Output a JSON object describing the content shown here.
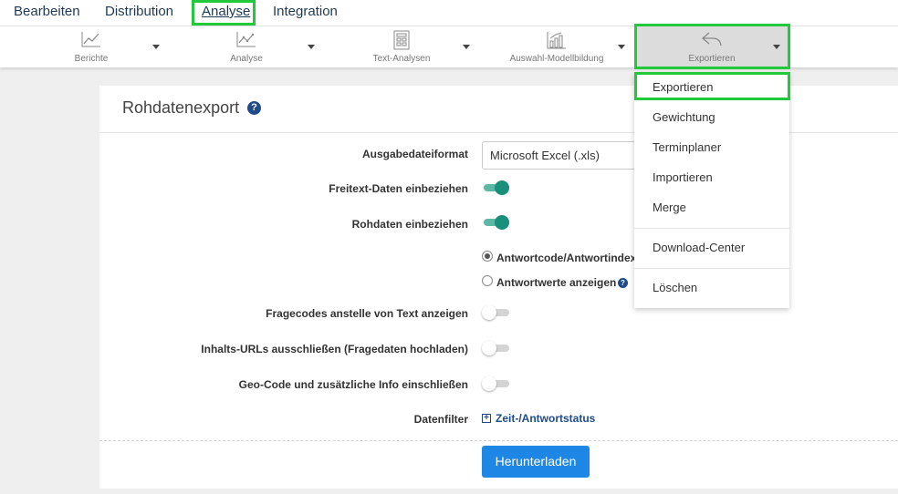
{
  "topmenu": {
    "items": [
      "Bearbeiten",
      "Distribution",
      "Analyse",
      "Integration"
    ],
    "active": "Analyse"
  },
  "toolbar": {
    "tools": [
      {
        "label": "Berichte",
        "icon": "line-chart-icon"
      },
      {
        "label": "Analyse",
        "icon": "scatter-chart-icon"
      },
      {
        "label": "Text-Analysen",
        "icon": "text-analysis-icon"
      },
      {
        "label": "Auswahl-Modellbildung",
        "icon": "model-chart-icon"
      },
      {
        "label": "Exportieren",
        "icon": "export-arrow-icon"
      }
    ]
  },
  "panel": {
    "title": "Rohdatenexport",
    "format_label": "Ausgabedateiformat",
    "format_value": "Microsoft Excel (.xls)",
    "freitext_label": "Freitext-Daten einbeziehen",
    "rohdaten_label": "Rohdaten einbeziehen",
    "radio_1": "Antwortcode/Antwortindex",
    "radio_2": "Antwortwerte anzeigen",
    "fragecodes_label": "Fragecodes anstelle von Text anzeigen",
    "urls_label": "Inhalts-URLs ausschließen (Fragedaten hochladen)",
    "geo_label": "Geo-Code und zusätzliche Info einschließen",
    "datenfilter_label": "Datenfilter",
    "datenfilter_link": "Zeit-/Antwortstatus",
    "download_button": "Herunterladen"
  },
  "dropdown": {
    "items": [
      "Exportieren",
      "Gewichtung",
      "Terminplaner",
      "Importieren",
      "Merge",
      "Download-Center",
      "Löschen"
    ]
  },
  "colors": {
    "highlight": "#22c93a",
    "toggle_on": "#1a8f7c",
    "button": "#1e87e5",
    "link": "#1f4b8c"
  }
}
